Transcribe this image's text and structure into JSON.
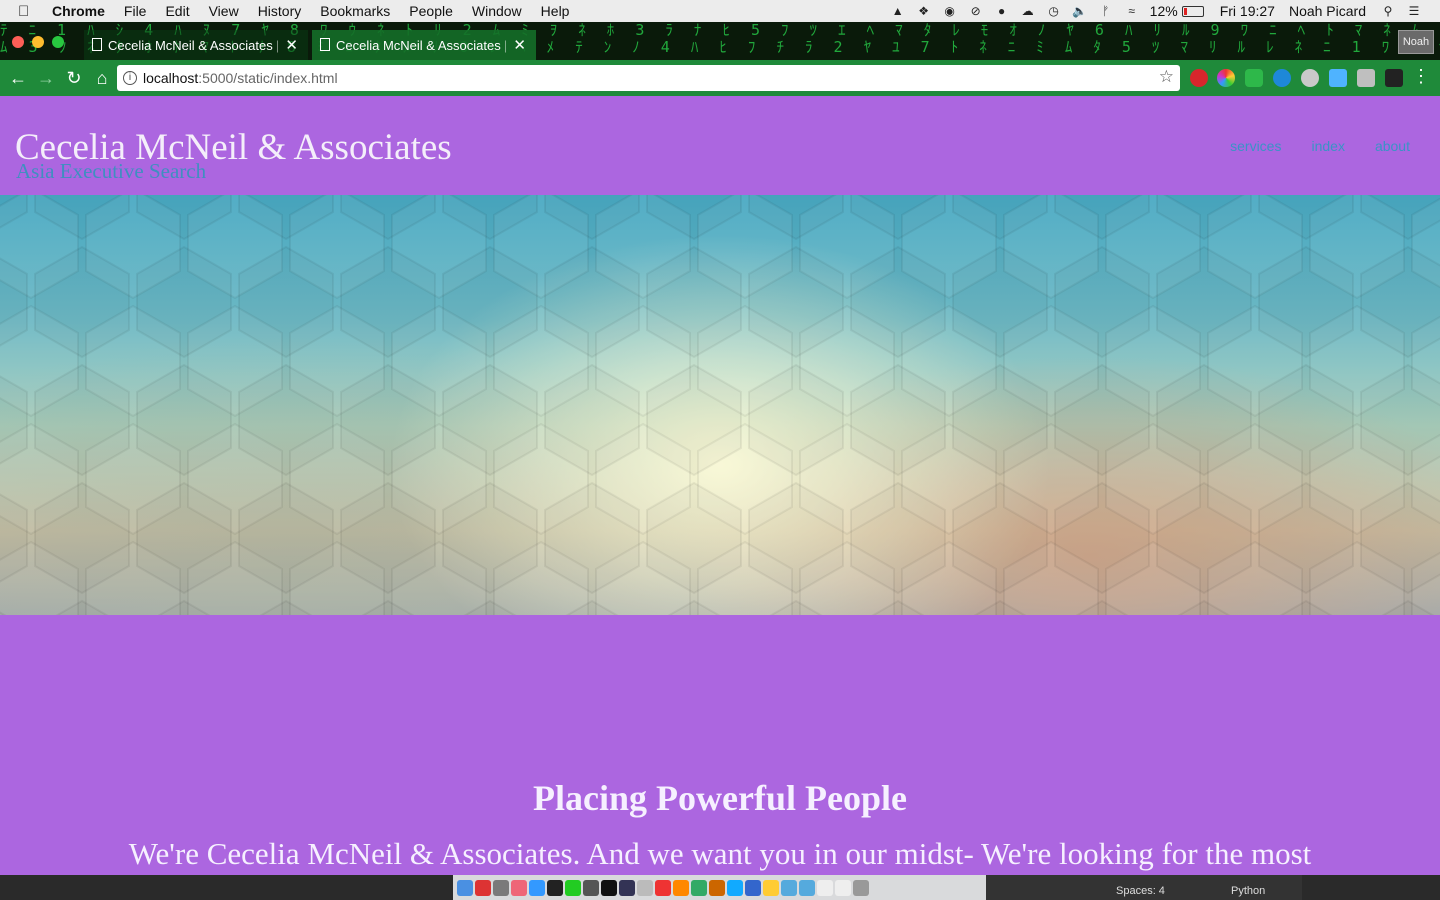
{
  "menubar": {
    "app_name": "Chrome",
    "items": [
      "File",
      "Edit",
      "View",
      "History",
      "Bookmarks",
      "People",
      "Window",
      "Help"
    ],
    "battery_percent": "12%",
    "clock": "Fri 19:27",
    "user": "Noah Picard"
  },
  "browser": {
    "tabs": [
      {
        "label": "Cecelia McNeil & Associates | ",
        "active": false
      },
      {
        "label": "Cecelia McNeil & Associates | ",
        "active": true
      }
    ],
    "profile_label": "Noah",
    "url_host": "localhost",
    "url_path": ":5000/static/index.html"
  },
  "site": {
    "title": "Cecelia McNeil & Associates",
    "subtitle": "Asia Executive Search",
    "nav": [
      "services",
      "index",
      "about"
    ],
    "headline": "Placing Powerful People",
    "intro": "We're Cecelia McNeil & Associates. And we want you in our midst- We're looking for the most"
  },
  "dock_status": {
    "spaces": "Spaces: 4",
    "language": "Python"
  },
  "colors": {
    "page_background": "#ac66e0",
    "nav_link": "#3a93c6",
    "toolbar": "#1f8a3a"
  }
}
